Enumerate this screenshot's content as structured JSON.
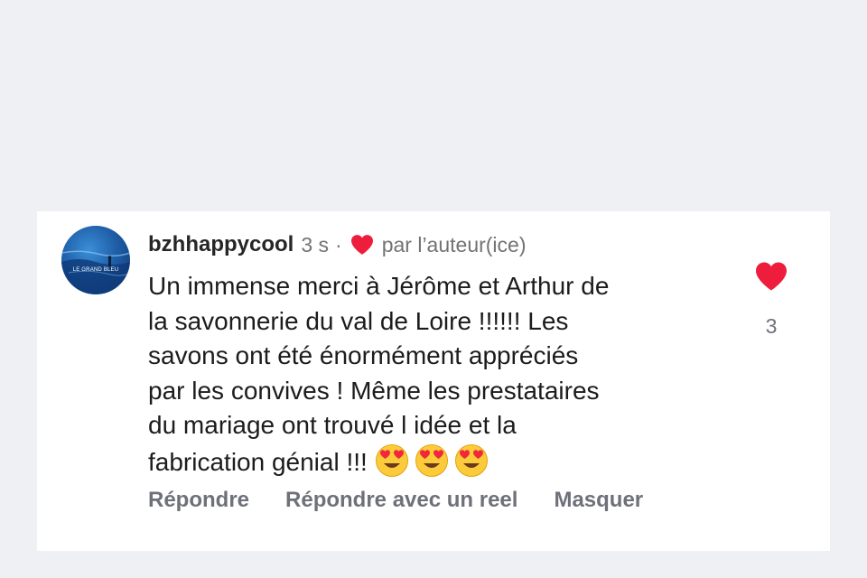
{
  "comment": {
    "avatar_text": "LE GRAND BLEU",
    "username": "bzhhappycool",
    "time": "3 s",
    "separator": "·",
    "liked_by_author_label": "par l’auteur(ice)",
    "text": "Un immense merci à Jérôme et Arthur de\nla savonnerie du val de Loire !!!!!! Les\nsavons ont été énormément appréciés\npar les convives ! Même les prestataires\ndu mariage ont trouvé l idée  et la\nfabrication génial !!! ",
    "emojis": [
      "heart-eyes-emoji",
      "heart-eyes-emoji",
      "heart-eyes-emoji"
    ],
    "like_count": "3",
    "actions": {
      "reply": "Répondre",
      "reply_reel": "Répondre avec un reel",
      "hide": "Masquer"
    }
  },
  "colors": {
    "background": "#eff0f4",
    "heart": "#ee1d3c",
    "secondary_text": "#737373"
  }
}
